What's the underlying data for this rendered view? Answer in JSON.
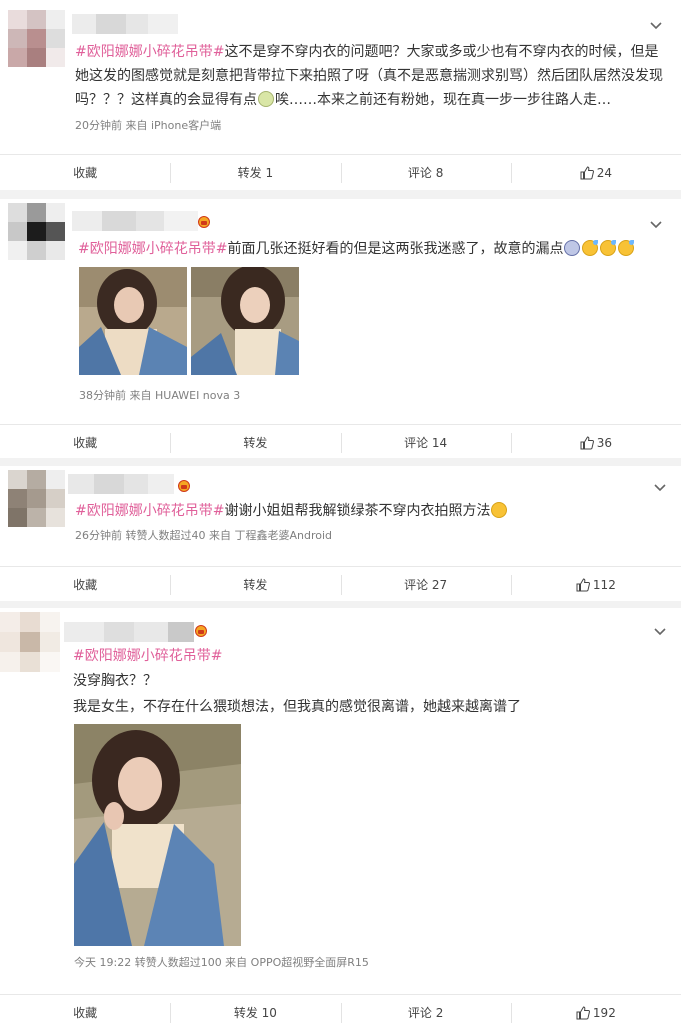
{
  "posts": [
    {
      "hashtag": "#欧阳娜娜小碎花吊带#",
      "text_line1": "这不是穿不穿内衣的问题吧？大家或多或少也有不穿内衣的时候，但是",
      "text_line2": "她这发的图感觉就是刻意把背带拉下来拍照了呀（真不是恶意揣测求别骂）然后团队居然没发现",
      "text_line3_a": "吗？？？这样真的会显得有点",
      "text_line3_b": "唉……本来之前还有粉她，现在真一步一步往路人走…",
      "meta": "20分钟前  来自 iPhone客户端",
      "actions": {
        "collect": "收藏",
        "repost": "转发 1",
        "comment": "评论 8",
        "like": "24"
      }
    },
    {
      "hashtag": "#欧阳娜娜小碎花吊带#",
      "text": "前面几张还挺好看的但是这两张我迷惑了，故意的漏点",
      "meta": "38分钟前  来自 HUAWEI nova 3",
      "actions": {
        "collect": "收藏",
        "repost": "转发",
        "comment": "评论 14",
        "like": "36"
      }
    },
    {
      "hashtag": "#欧阳娜娜小碎花吊带#",
      "text": "谢谢小姐姐帮我解锁绿茶不穿内衣拍照方法",
      "meta": "26分钟前 转赞人数超过40  来自 丁程鑫老婆Android",
      "actions": {
        "collect": "收藏",
        "repost": "转发",
        "comment": "评论 27",
        "like": "112"
      }
    },
    {
      "hashtag": "#欧阳娜娜小碎花吊带#",
      "line1": "没穿胸衣？？",
      "line2": "我是女生，不存在什么猥琐想法，但我真的感觉很离谱，她越来越离谱了",
      "meta": "今天 19:22 转赞人数超过100  来自 OPPO超视野全面屏R15",
      "actions": {
        "collect": "收藏",
        "repost": "转发 10",
        "comment": "评论 2",
        "like": "192"
      }
    }
  ],
  "icons": {
    "expand": "chevron-down-icon",
    "like": "thumbs-up-icon",
    "crown": "vip-crown-icon",
    "emoji": "emoji-icon"
  },
  "colors": {
    "hashtag": "#e0609a",
    "meta": "#808080",
    "background": "#f2f2f2"
  }
}
